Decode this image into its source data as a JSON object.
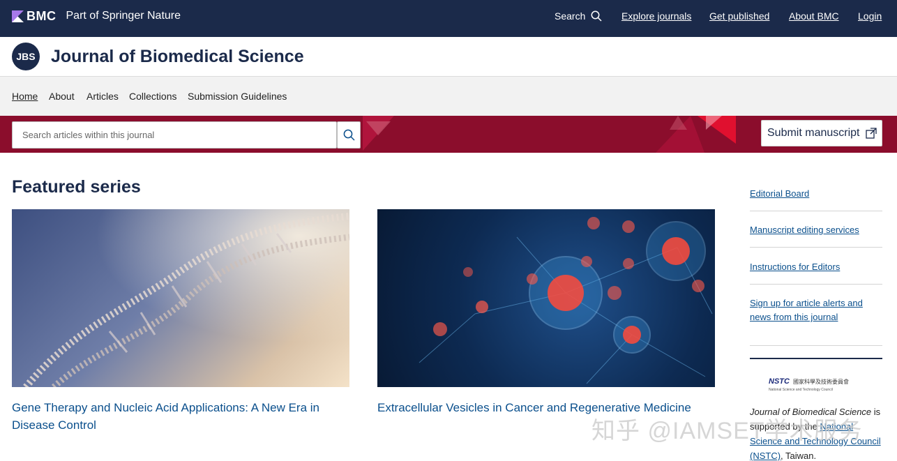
{
  "topbar": {
    "brand": "BMC",
    "tagline": "Part of Springer Nature",
    "nav": {
      "search": "Search",
      "explore": "Explore journals",
      "get_published": "Get published",
      "about": "About BMC",
      "login": "Login"
    }
  },
  "journal": {
    "logo_text": "JBS",
    "title": "Journal of Biomedical Science"
  },
  "subnav": {
    "items": [
      "Home",
      "About",
      "Articles",
      "Collections",
      "Submission Guidelines"
    ]
  },
  "search": {
    "placeholder": "Search articles within this journal",
    "submit_label": "Submit manuscript"
  },
  "featured": {
    "title": "Featured series",
    "cards": [
      {
        "title": "Gene Therapy and Nucleic Acid Applications: A New Era in Disease Control"
      },
      {
        "title": "Extracellular Vesicles in Cancer and Regenerative Medicine"
      }
    ]
  },
  "sidebar": {
    "links": [
      "Editorial Board",
      "Manuscript editing services",
      "Instructions for Editors",
      "Sign up for article alerts and news from this journal"
    ],
    "nstc_mark": "NSTC",
    "nstc_zh": "國家科學及技術委員會",
    "nstc_en": "National Science and Technology Council",
    "support_journal": "Journal of Biomedical Science",
    "support_text": " is supported by the ",
    "support_link": "National Science and Technology Council (NSTC)",
    "support_tail": ", Taiwan."
  },
  "watermark": "知乎 @IAMSET学术服务",
  "colors": {
    "topbar": "#1b2a4a",
    "band": "#8b0d2c",
    "link": "#0a4f8c",
    "accent_purple": "#a779e9"
  }
}
